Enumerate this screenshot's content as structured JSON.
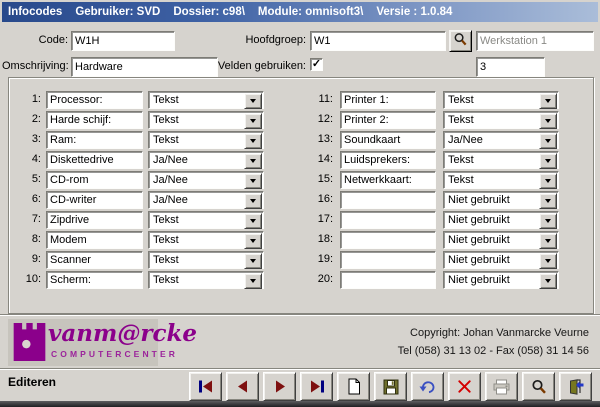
{
  "title_bar": {
    "segments": [
      "Infocodes",
      "Gebruiker: SVD",
      "Dossier: c98\\",
      "Module: omnisoft3\\",
      "Versie : 1.0.84"
    ]
  },
  "header_form": {
    "code_label": "Code:",
    "code_value": "W1H",
    "omschrijving_label": "Omschrijving:",
    "omschrijving_value": "Hardware",
    "hoofdgroep_label": "Hoofdgroep:",
    "hoofdgroep_value": "W1",
    "hoofdgroep_name": "Werkstation 1",
    "velden_label": "Velden gebruiken:",
    "velden_checked": true,
    "aantal_value": "3"
  },
  "fields": {
    "rows": [
      {
        "num": "1:",
        "label": "Processor:",
        "type": "Tekst"
      },
      {
        "num": "2:",
        "label": "Harde schijf:",
        "type": "Tekst"
      },
      {
        "num": "3:",
        "label": "Ram:",
        "type": "Tekst"
      },
      {
        "num": "4:",
        "label": "Diskettedrive",
        "type": "Ja/Nee"
      },
      {
        "num": "5:",
        "label": "CD-rom",
        "type": "Ja/Nee"
      },
      {
        "num": "6:",
        "label": "CD-writer",
        "type": "Ja/Nee"
      },
      {
        "num": "7:",
        "label": "Zipdrive",
        "type": "Tekst"
      },
      {
        "num": "8:",
        "label": "Modem",
        "type": "Tekst"
      },
      {
        "num": "9:",
        "label": "Scanner",
        "type": "Tekst"
      },
      {
        "num": "10:",
        "label": "Scherm:",
        "type": "Tekst"
      },
      {
        "num": "11:",
        "label": "Printer 1:",
        "type": "Tekst"
      },
      {
        "num": "12:",
        "label": "Printer 2:",
        "type": "Tekst"
      },
      {
        "num": "13:",
        "label": "Soundkaart",
        "type": "Ja/Nee"
      },
      {
        "num": "14:",
        "label": "Luidsprekers:",
        "type": "Tekst"
      },
      {
        "num": "15:",
        "label": "Netwerkkaart:",
        "type": "Tekst"
      },
      {
        "num": "16:",
        "label": "",
        "type": "Niet gebruikt"
      },
      {
        "num": "17:",
        "label": "",
        "type": "Niet gebruikt"
      },
      {
        "num": "18:",
        "label": "",
        "type": "Niet gebruikt"
      },
      {
        "num": "19:",
        "label": "",
        "type": "Niet gebruikt"
      },
      {
        "num": "20:",
        "label": "",
        "type": "Niet gebruikt"
      }
    ]
  },
  "footer": {
    "brand_name": "vanm@rcke",
    "brand_sub": "COMPUTERCENTER",
    "copyright_line": "Copyright:  Johan Vanmarcke  Veurne",
    "telfax_line": "Tel (058) 31 13 02  -  Fax (058) 31 14 56"
  },
  "toolbar": {
    "mode_label": "Editeren",
    "buttons": [
      {
        "name": "first-record-button",
        "icon": "first-record-icon",
        "disabled": false
      },
      {
        "name": "prior-record-button",
        "icon": "prior-record-icon",
        "disabled": false
      },
      {
        "name": "next-record-button",
        "icon": "next-record-icon",
        "disabled": false
      },
      {
        "name": "last-record-button",
        "icon": "last-record-icon",
        "disabled": false
      },
      {
        "name": "new-record-button",
        "icon": "new-document-icon",
        "disabled": false
      },
      {
        "name": "save-button",
        "icon": "save-icon",
        "disabled": false
      },
      {
        "name": "undo-button",
        "icon": "undo-icon",
        "disabled": false
      },
      {
        "name": "delete-button",
        "icon": "delete-icon",
        "disabled": false
      },
      {
        "name": "print-button",
        "icon": "printer-icon",
        "disabled": true
      },
      {
        "name": "search-button",
        "icon": "search-icon",
        "disabled": false
      },
      {
        "name": "exit-button",
        "icon": "exit-door-icon",
        "disabled": false
      }
    ]
  },
  "colors": {
    "titlebar_left": "#28498b",
    "titlebar_right": "#aabdd9",
    "window_bg": "#d6d3ce",
    "brand_purple": "#8b008b",
    "nav_arrow_red": "#7e1010",
    "nav_bar_blue": "#000080",
    "delete_red": "#d40000",
    "undo_blue": "#3a50c2"
  }
}
